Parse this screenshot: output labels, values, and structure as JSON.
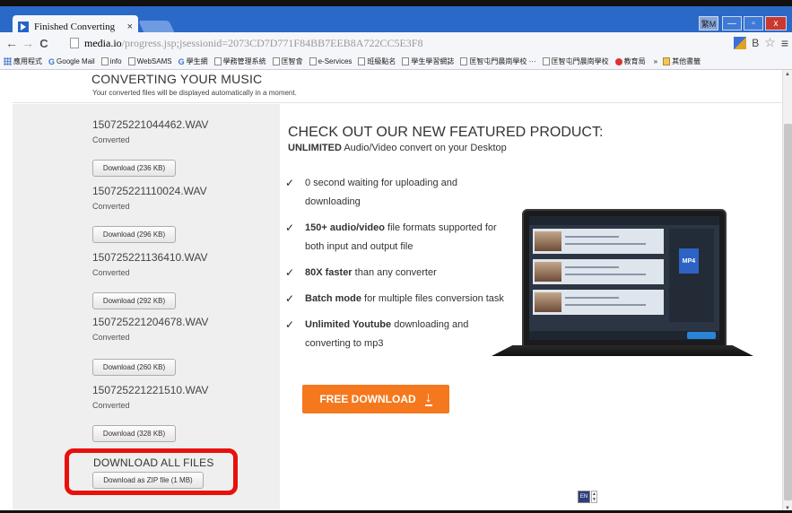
{
  "browser": {
    "tab_title": "Finished Converting",
    "tab_close": "×",
    "url_host": "media.io",
    "url_rest": "/progress.jsp;jsessionid=2073CD7D771F84BB7EEB8A722CC5E3F8",
    "ime_label": "繁M",
    "min_glyph": "—",
    "max_glyph": "▫",
    "close_glyph": "x",
    "back_glyph": "←",
    "forward_glyph": "→",
    "reload_glyph": "C",
    "star_glyph": "☆",
    "menu_glyph": "≡"
  },
  "bookmarks": {
    "items": [
      {
        "label": "應用程式",
        "icon": "apps-icon"
      },
      {
        "label": "Google Mail",
        "icon": "google-icon"
      },
      {
        "label": "info",
        "icon": "page-icon"
      },
      {
        "label": "WebSAMS",
        "icon": "page-icon"
      },
      {
        "label": "學生網",
        "icon": "google-icon"
      },
      {
        "label": "學務管理系統",
        "icon": "page-icon"
      },
      {
        "label": "匡智會",
        "icon": "page-icon"
      },
      {
        "label": "e-Services",
        "icon": "page-icon"
      },
      {
        "label": "班級點名",
        "icon": "page-icon"
      },
      {
        "label": "學生學習網誌",
        "icon": "page-icon"
      },
      {
        "label": "匡智屯門晨崗學校 ···",
        "icon": "page-icon"
      },
      {
        "label": "匡智屯門晨崗學校",
        "icon": "page-icon"
      },
      {
        "label": "教育局",
        "icon": "red-circle-icon"
      }
    ],
    "more": "»",
    "other_folder": "其他書籤"
  },
  "page": {
    "header_title": "CONVERTING YOUR MUSIC",
    "header_sub": "Your converted files will be displayed automatically in a moment.",
    "files": [
      {
        "name": "150725221044462.WAV",
        "status": "Converted",
        "download": "Download (236 KB)"
      },
      {
        "name": "150725221110024.WAV",
        "status": "Converted",
        "download": "Download (296 KB)"
      },
      {
        "name": "150725221136410.WAV",
        "status": "Converted",
        "download": "Download (292 KB)"
      },
      {
        "name": "150725221204678.WAV",
        "status": "Converted",
        "download": "Download (260 KB)"
      },
      {
        "name": "150725221221510.WAV",
        "status": "Converted",
        "download": "Download (328 KB)"
      }
    ],
    "download_all_title": "DOWNLOAD ALL FILES",
    "download_zip": "Download as ZIP file (1 MB)"
  },
  "promo": {
    "title": "CHECK OUT OUR NEW FEATURED PRODUCT:",
    "sub_bold": "UNLIMITED",
    "sub_rest": " Audio/Video convert on your Desktop",
    "features": [
      {
        "bold": "",
        "text": "0 second waiting for uploading and downloading"
      },
      {
        "bold": "150+ audio/video",
        "text": " file formats supported for both input and output file"
      },
      {
        "bold": "80X faster",
        "text": " than any converter"
      },
      {
        "bold": "Batch mode",
        "text": " for multiple files conversion task"
      },
      {
        "bold": "Unlimited Youtube",
        "text": " downloading and converting to mp3"
      }
    ],
    "check_glyph": "✓",
    "free_download": "FREE DOWNLOAD",
    "arrow_glyph": "↓",
    "screen_badge": "MP4"
  },
  "lang": {
    "code": "EN",
    "up": "▲",
    "down": "▼"
  },
  "scroll": {
    "up": "▲",
    "down": "▼"
  },
  "colors": {
    "accent_orange": "#f5781e",
    "highlight_red": "#e8100b",
    "titlebar_blue": "#2b69c9"
  }
}
